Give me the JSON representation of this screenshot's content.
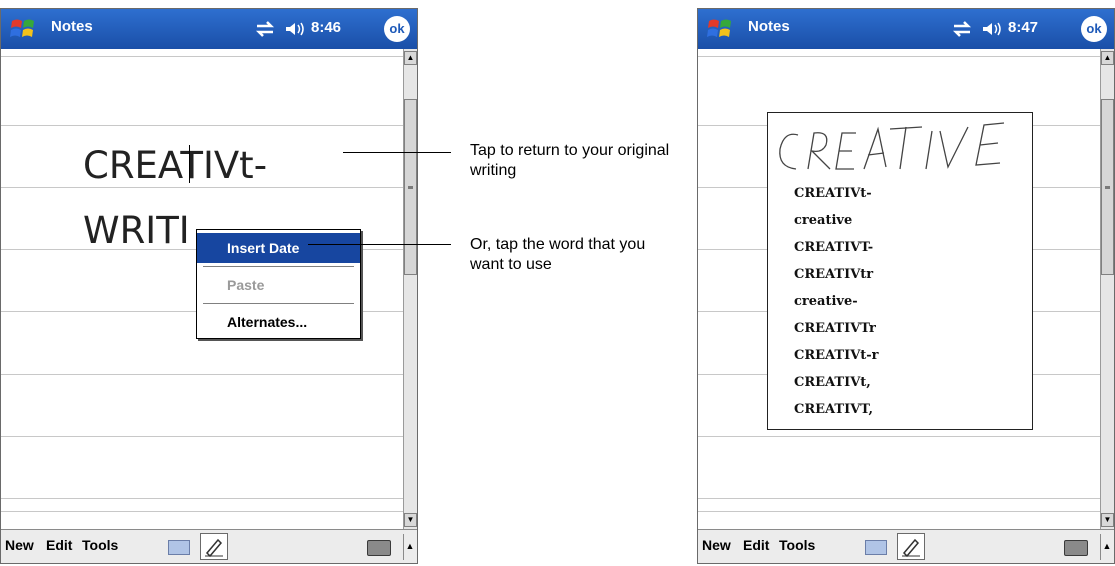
{
  "screens": [
    {
      "app_title": "Notes",
      "clock": "8:46",
      "ok_label": "ok",
      "menu": [
        "New",
        "Edit",
        "Tools"
      ],
      "text_lines": [
        "CREATIVt-",
        "WRITI"
      ],
      "context_menu": [
        {
          "label": "Insert Date",
          "state": "selected"
        },
        {
          "label": "Paste",
          "state": "disabled"
        },
        {
          "label": "Alternates...",
          "state": "normal"
        }
      ]
    },
    {
      "app_title": "Notes",
      "clock": "8:47",
      "ok_label": "ok",
      "menu": [
        "New",
        "Edit",
        "Tools"
      ],
      "handwriting_label": "CREATIVE",
      "alternates": [
        "CREATIVt-",
        "creative",
        "CREATIVT-",
        "CREATIVtr",
        "creative-",
        "CREATIVTr",
        "CREATIVt-r",
        "CREATIVt,",
        "CREATIVT,"
      ]
    }
  ],
  "callouts": [
    {
      "text": "Tap to return to your original writing"
    },
    {
      "text": "Or, tap the word that you want to use"
    }
  ],
  "colors": {
    "titlebar": "#1d59b8",
    "selection": "#1746a0"
  }
}
